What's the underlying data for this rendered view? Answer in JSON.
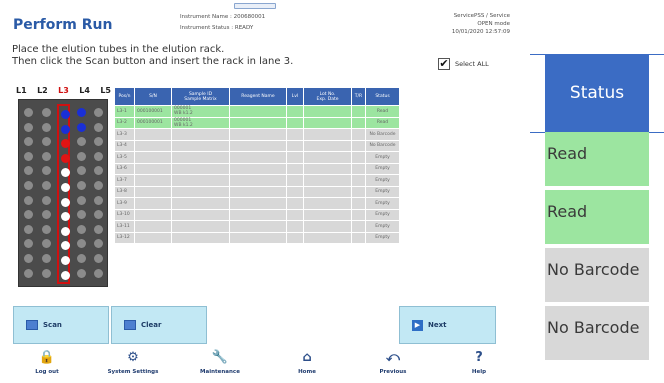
{
  "header": {
    "title": "Perform Run",
    "instrument_name": "Instrument Name : 200680001",
    "instrument_status": "Instrument Status : READY",
    "user": "ServicePSS / Service",
    "mode": "OPEN mode",
    "datetime": "10/01/2020 12:57:09"
  },
  "instructions": {
    "line1": "Place the elution tubes in the elution rack.",
    "line2": "Then click the Scan button and insert the rack in lane 3."
  },
  "select_all": {
    "label": "Select ALL",
    "checked": true
  },
  "rack": {
    "lanes": [
      "L1",
      "L2",
      "L3",
      "L4",
      "L5"
    ],
    "active_lane": "L3",
    "colors": {
      "rack": "#4b4b4b",
      "empty": "#8b8b8b",
      "blue": "#1a2fd6",
      "red": "#e01414",
      "white": "#ffffff",
      "highlight": "#d01010"
    }
  },
  "table": {
    "columns": [
      "Pos/n",
      "S/N",
      "Sample ID\nSample Matrix",
      "Reagent Name",
      "Lvl",
      "Lot No.\nExp. Date",
      "T/R",
      "Status"
    ],
    "rows": [
      {
        "pos": "L3-1",
        "sn": "000100001",
        "sample": "000001\nWB k1.2",
        "lvl": "",
        "tr": "",
        "status": "Read",
        "state": "read"
      },
      {
        "pos": "L3-2",
        "sn": "000100001",
        "sample": "000001\nWB k1.2",
        "lvl": "",
        "tr": "",
        "status": "Read",
        "state": "read"
      },
      {
        "pos": "L3-3",
        "sn": "",
        "sample": "",
        "lvl": "",
        "tr": "",
        "status": "No Barcode",
        "state": "gray"
      },
      {
        "pos": "L3-4",
        "sn": "",
        "sample": "",
        "lvl": "",
        "tr": "",
        "status": "No Barcode",
        "state": "gray"
      },
      {
        "pos": "L3-5",
        "sn": "",
        "sample": "",
        "lvl": "",
        "tr": "",
        "status": "Empty",
        "state": "gray"
      },
      {
        "pos": "L3-6",
        "sn": "",
        "sample": "",
        "lvl": "",
        "tr": "",
        "status": "Empty",
        "state": "gray"
      },
      {
        "pos": "L3-7",
        "sn": "",
        "sample": "",
        "lvl": "",
        "tr": "",
        "status": "Empty",
        "state": "gray"
      },
      {
        "pos": "L3-8",
        "sn": "",
        "sample": "",
        "lvl": "",
        "tr": "",
        "status": "Empty",
        "state": "gray"
      },
      {
        "pos": "L3-9",
        "sn": "",
        "sample": "",
        "lvl": "",
        "tr": "",
        "status": "Empty",
        "state": "gray"
      },
      {
        "pos": "L3-10",
        "sn": "",
        "sample": "",
        "lvl": "",
        "tr": "",
        "status": "Empty",
        "state": "gray"
      },
      {
        "pos": "L3-11",
        "sn": "",
        "sample": "",
        "lvl": "",
        "tr": "",
        "status": "Empty",
        "state": "gray"
      },
      {
        "pos": "L3-12",
        "sn": "",
        "sample": "",
        "lvl": "",
        "tr": "",
        "status": "Empty",
        "state": "gray"
      }
    ]
  },
  "actions": {
    "scan": "Scan",
    "clear": "Clear",
    "next": "Next"
  },
  "footer": {
    "logout": "Log out",
    "settings": "System Settings",
    "maintenance": "Maintenance",
    "home": "Home",
    "previous": "Previous",
    "help": "Help"
  },
  "zoom": {
    "header": "Status",
    "cells": [
      {
        "label": "Read",
        "state": "read"
      },
      {
        "label": "Read",
        "state": "read"
      },
      {
        "label": "No Barcode",
        "state": "gray"
      },
      {
        "label": "No Barcode",
        "state": "gray"
      }
    ]
  },
  "icons": {
    "logout": "lock-icon",
    "settings": "gear-icon",
    "maintenance": "wrench-icon",
    "home": "house-icon",
    "previous": "previous-icon",
    "help": "help-icon",
    "scan": "scan-icon",
    "clear": "clear-icon",
    "next": "next-icon"
  }
}
